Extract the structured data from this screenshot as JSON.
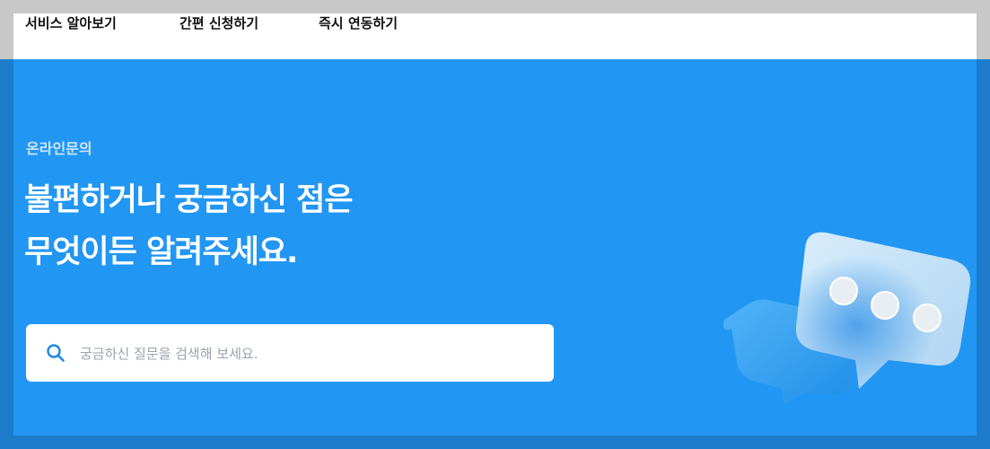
{
  "nav": {
    "items": [
      "서비스 알아보기",
      "간편 신청하기",
      "즉시 연동하기"
    ]
  },
  "hero": {
    "eyebrow": "온라인문의",
    "headline_line1": "불편하거나 궁금하신 점은",
    "headline_line2": "무엇이든 알려주세요."
  },
  "search": {
    "placeholder": "궁금하신 질문을 검색해 보세요.",
    "value": "",
    "icon": "search-icon"
  },
  "illustration": {
    "icon": "chat-bubbles-icon"
  },
  "colors": {
    "hero_bg": "#2196f3",
    "backdrop": "#c8c8c8",
    "accent": "#1e88e5"
  }
}
